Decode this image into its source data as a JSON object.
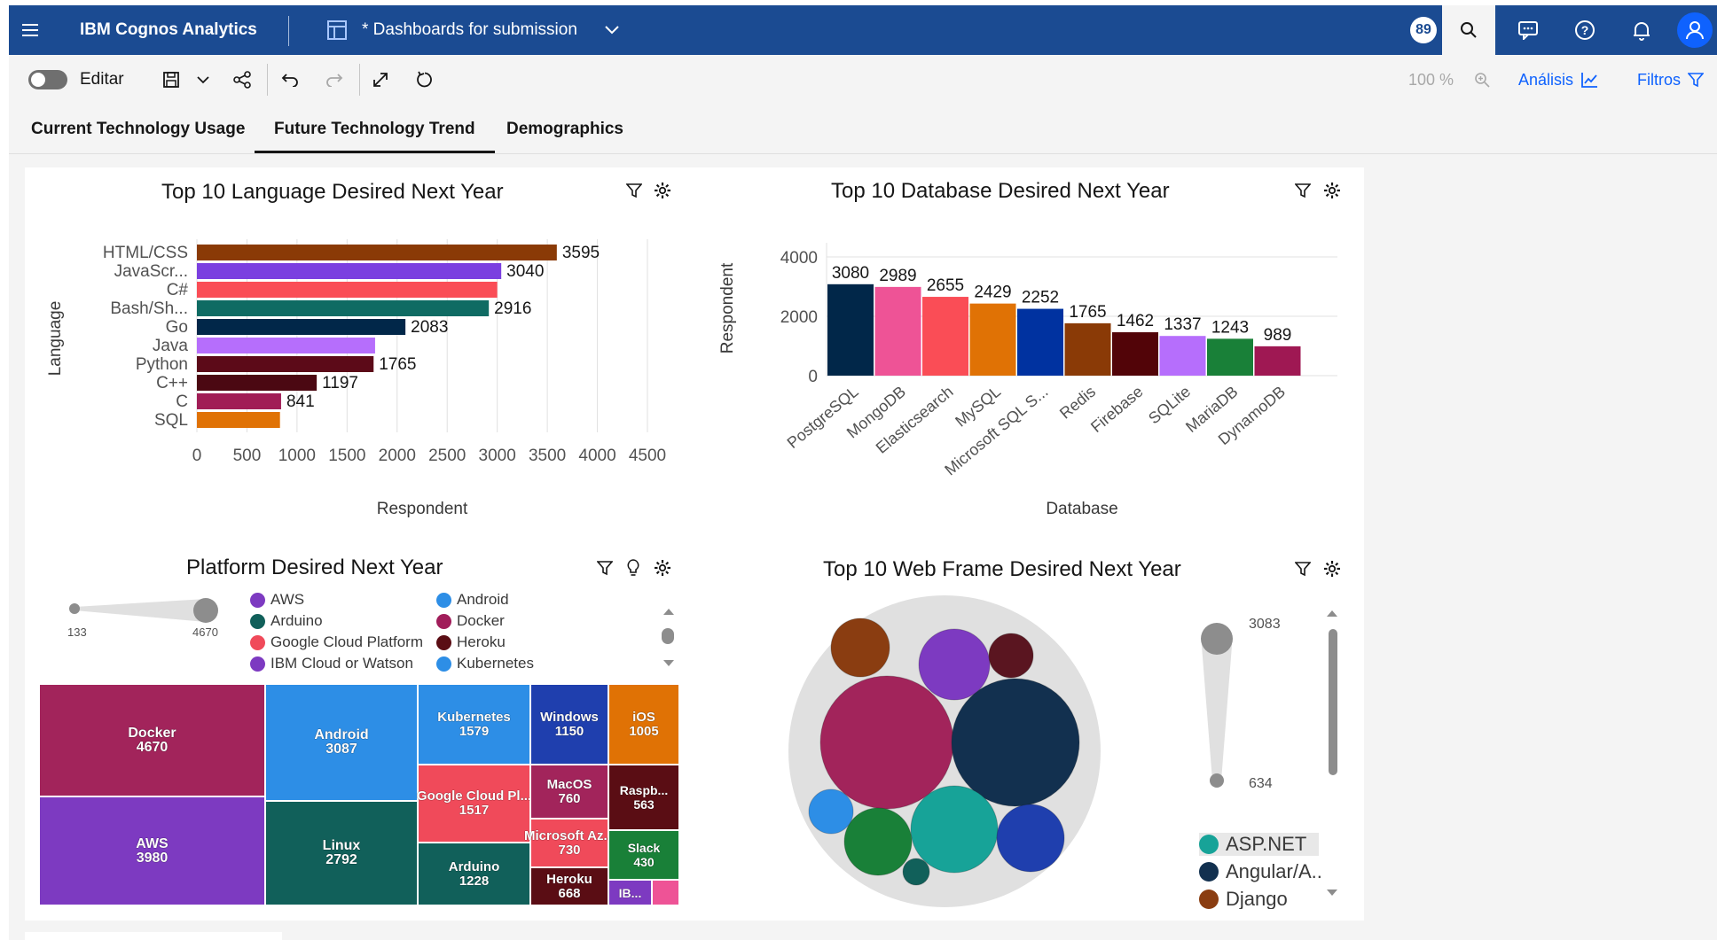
{
  "app": {
    "menu_icon": "hamburger-icon",
    "product": "IBM Cognos Analytics",
    "dashboard_title": "* Dashboards for submission",
    "notification_count": "89",
    "brand_color": "#1b4b92"
  },
  "toolbar": {
    "edit_label": "Editar",
    "zoom": "100 %",
    "analysis_label": "Análisis",
    "filters_label": "Filtros"
  },
  "tabs": [
    {
      "label": "Current Technology Usage"
    },
    {
      "label": "Future Technology Trend"
    },
    {
      "label": "Demographics"
    }
  ],
  "widgets": {
    "language": {
      "title": "Top 10 Language Desired Next Year"
    },
    "database": {
      "title": "Top 10 Database Desired Next Year"
    },
    "platform": {
      "title": "Platform Desired Next Year",
      "slider_min": "133",
      "slider_max": "4670",
      "legend": [
        {
          "label": "AWS",
          "color": "#7d3ac1"
        },
        {
          "label": "Android",
          "color": "#2d8ee6"
        },
        {
          "label": "Arduino",
          "color": "#11605a"
        },
        {
          "label": "Docker",
          "color": "#a11d5a"
        },
        {
          "label": "Google Cloud Platform",
          "color": "#f04a5a"
        },
        {
          "label": "Heroku",
          "color": "#5a0d14"
        },
        {
          "label": "IBM Cloud or Watson",
          "color": "#7d3ac1"
        },
        {
          "label": "Kubernetes",
          "color": "#2d8ee6"
        }
      ]
    },
    "webframe": {
      "title": "Top 10 Web Frame Desired Next Year",
      "slider_max": "3083",
      "slider_min": "634",
      "legend": [
        {
          "label": "ASP.NET",
          "color": "#17a398"
        },
        {
          "label": "Angular/A..",
          "color": "#12304f"
        },
        {
          "label": "Django",
          "color": "#8a3d11"
        }
      ]
    }
  },
  "chart_data": [
    {
      "type": "bar",
      "orientation": "horizontal",
      "title": "Top 10 Language Desired Next Year",
      "xlabel": "Respondent",
      "ylabel": "Language",
      "xlim": [
        0,
        4500
      ],
      "xticks": [
        "0",
        "500",
        "1000",
        "1500",
        "2000",
        "2500",
        "3000",
        "3500",
        "4000",
        "4500"
      ],
      "categories": [
        "HTML/CSS",
        "JavaScr...",
        "C#",
        "Bash/Sh...",
        "Go",
        "Java",
        "Python",
        "C++",
        "C",
        "SQL"
      ],
      "values": [
        3595,
        3040,
        3000,
        2916,
        2083,
        1780,
        1765,
        1197,
        841,
        830
      ],
      "data_labels": [
        "3595",
        "3040",
        "",
        "2916",
        "2083",
        "",
        "1765",
        "1197",
        "841",
        ""
      ],
      "colors": [
        "#8a3a06",
        "#7b3fe0",
        "#fa4d56",
        "#0f6b63",
        "#012749",
        "#b66efc",
        "#5c0a18",
        "#4b0812",
        "#a11d56",
        "#e07205"
      ]
    },
    {
      "type": "bar",
      "title": "Top 10 Database Desired Next Year",
      "xlabel": "Database",
      "ylabel": "Respondent",
      "ylim": [
        0,
        4500
      ],
      "yticks": [
        "0",
        "2000",
        "4000"
      ],
      "categories": [
        "PostgreSQL",
        "MongoDB",
        "Elasticsearch",
        "MySQL",
        "Microsoft SQL S...",
        "Redis",
        "Firebase",
        "SQLite",
        "MariaDB",
        "DynamoDB"
      ],
      "values": [
        3080,
        2989,
        2655,
        2429,
        2252,
        1765,
        1462,
        1337,
        1243,
        989
      ],
      "colors": [
        "#012749",
        "#ee5396",
        "#fa4d56",
        "#e07205",
        "#0032a0",
        "#8a3a06",
        "#520408",
        "#b66efc",
        "#198038",
        "#9f1853"
      ]
    },
    {
      "type": "treemap",
      "title": "Platform Desired Next Year",
      "items": [
        {
          "label": "Docker",
          "value": 4670,
          "color": "#a2245b"
        },
        {
          "label": "AWS",
          "value": 3980,
          "color": "#7d3ac1"
        },
        {
          "label": "Android",
          "value": 3087,
          "color": "#2d8ee6"
        },
        {
          "label": "Linux",
          "value": 2792,
          "color": "#11605a"
        },
        {
          "label": "Kubernetes",
          "value": 1579,
          "color": "#2d8ee6"
        },
        {
          "label": "Google Cloud Pl...",
          "value": 1517,
          "color": "#f04a5a"
        },
        {
          "label": "Arduino",
          "value": 1228,
          "color": "#11605a"
        },
        {
          "label": "Windows",
          "value": 1150,
          "color": "#1f3fae"
        },
        {
          "label": "iOS",
          "value": 1005,
          "color": "#e07205"
        },
        {
          "label": "MacOS",
          "value": 760,
          "color": "#a2245b"
        },
        {
          "label": "Microsoft Az...",
          "value": 730,
          "color": "#f04a5a"
        },
        {
          "label": "Heroku",
          "value": 668,
          "color": "#5a0d14"
        },
        {
          "label": "Raspb...",
          "value": 563,
          "color": "#5a0d14"
        },
        {
          "label": "Slack",
          "value": 430,
          "color": "#198038"
        },
        {
          "label": "IB...",
          "value": 0,
          "color": "#7d3ac1"
        },
        {
          "label": "",
          "value": 0,
          "color": "#ee5396"
        }
      ],
      "visible_labels": [
        "Docker\n4670",
        "AWS\n3980",
        "Android\n3087",
        "Linux\n2792",
        "Kubernetes\n1579",
        "Google Cloud Pl...\n1517",
        "Arduino\n1228",
        "Windows\n1150",
        "iOS\n1005",
        "MacOS\n760",
        "Microsoft Az...\n730",
        "Heroku\n668",
        "Raspb...\n563",
        "Slack\n430",
        "IB..."
      ]
    },
    {
      "type": "packed-bubble",
      "title": "Top 10 Web Frame Desired Next Year",
      "size_range": [
        634,
        3083
      ],
      "bubbles": [
        {
          "color": "#a2245b"
        },
        {
          "color": "#12304f"
        },
        {
          "color": "#17a398"
        },
        {
          "color": "#7d3ac1"
        },
        {
          "color": "#8a3d11"
        },
        {
          "color": "#5a1520"
        },
        {
          "color": "#1f3fae"
        },
        {
          "color": "#198038"
        },
        {
          "color": "#2d8ee6"
        },
        {
          "color": "#11605a"
        }
      ]
    }
  ]
}
